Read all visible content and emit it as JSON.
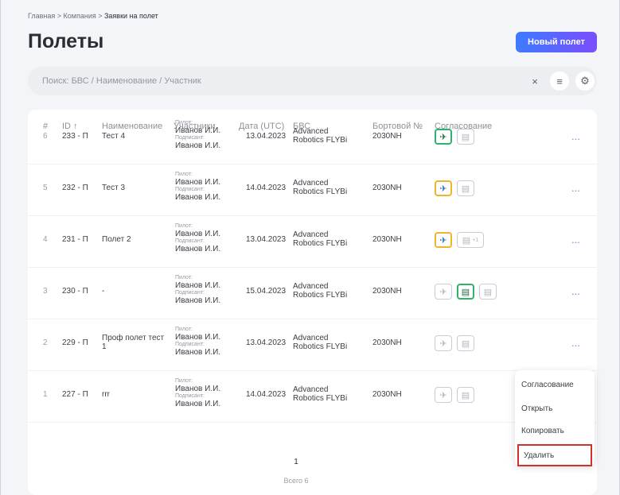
{
  "breadcrumb": {
    "home": "Главная",
    "sep": " > ",
    "company": "Компания",
    "current": "Заявки на полет"
  },
  "page": {
    "title": "Полеты",
    "new_button": "Новый полет"
  },
  "search": {
    "placeholder": "Поиск: БВС / Наименование / Участник",
    "clear": "×",
    "filter": "≡",
    "settings": "⚙"
  },
  "table": {
    "headers": [
      "#",
      "ID ↑",
      "Наименование",
      "Участники",
      "Дата (UTC)",
      "БВС",
      "Бортовой №",
      "Согласование"
    ],
    "rows": [
      {
        "n": "6",
        "id": "233 - П",
        "name": "Тест 4",
        "pilot_label": "Пилот:",
        "pilot": "Иванов И.И.",
        "sign_label": "Подписант:",
        "signer": "Иванов И.И.",
        "date": "13.04.2023",
        "bbc1": "Advanced",
        "bbc2": "Robotics FLYBi",
        "board": "2030NH",
        "more": "..."
      },
      {
        "n": "5",
        "id": "232 - П",
        "name": "Тест 3",
        "pilot_label": "Пилот:",
        "pilot": "Иванов И.И.",
        "sign_label": "Подписант:",
        "signer": "Иванов И.И.",
        "date": "14.04.2023",
        "bbc1": "Advanced",
        "bbc2": "Robotics FLYBi",
        "board": "2030NH",
        "more": "..."
      },
      {
        "n": "4",
        "id": "231 - П",
        "name": "Полет 2",
        "pilot_label": "Пилот:",
        "pilot": "Иванов И.И.",
        "sign_label": "Подписант:",
        "signer": "Иванов И.И.",
        "date": "13.04.2023",
        "bbc1": "Advanced",
        "bbc2": "Robotics FLYBi",
        "board": "2030NH",
        "more": "...",
        "plus": "+1"
      },
      {
        "n": "3",
        "id": "230 - П",
        "name": "-",
        "pilot_label": "Пилот:",
        "pilot": "Иванов И.И.",
        "sign_label": "Подписант:",
        "signer": "Иванов И.И.",
        "date": "15.04.2023",
        "bbc1": "Advanced",
        "bbc2": "Robotics FLYBi",
        "board": "2030NH",
        "more": "..."
      },
      {
        "n": "2",
        "id": "229 - П",
        "name": "Проф полет тест",
        "name2": "1",
        "pilot_label": "Пилот:",
        "pilot": "Иванов И.И.",
        "sign_label": "Подписант:",
        "signer": "Иванов И.И.",
        "date": "13.04.2023",
        "bbc1": "Advanced",
        "bbc2": "Robotics FLYBi",
        "board": "2030NH",
        "more": "..."
      },
      {
        "n": "1",
        "id": "227 - П",
        "name": "rrr",
        "pilot_label": "Пилот:",
        "pilot": "Иванов И.И.",
        "sign_label": "Подписант:",
        "signer": "Иванов И.И.",
        "date": "14.04.2023",
        "bbc1": "Advanced",
        "bbc2": "Robotics FLYBi",
        "board": "2030NH"
      }
    ]
  },
  "menu": {
    "items": [
      "Согласование",
      "Открыть",
      "Копировать",
      "Удалить"
    ]
  },
  "pagination": {
    "page": "1",
    "total": "Всего 6"
  },
  "colors": {
    "accent_start": "#3d7bff",
    "accent_end": "#7a4dff",
    "approved": "#2fb36b",
    "pending": "#f0b52a",
    "delete_highlight": "#d0312d"
  }
}
